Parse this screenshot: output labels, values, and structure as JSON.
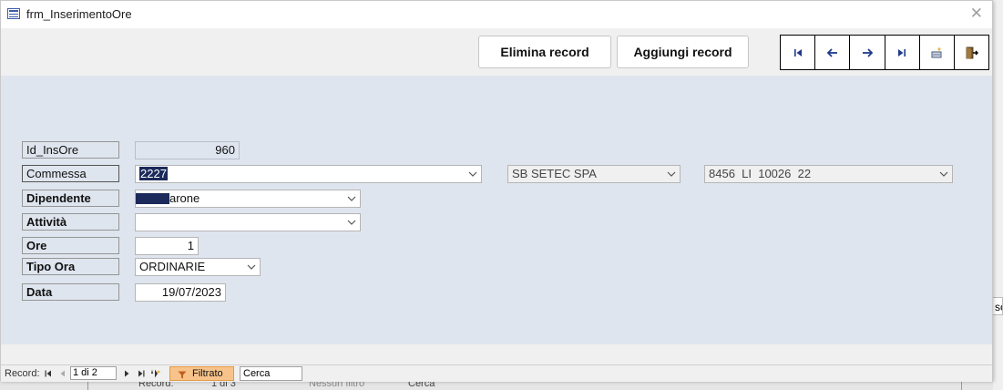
{
  "window": {
    "title": "frm_InserimentoOre"
  },
  "toolbar": {
    "delete_label": "Elimina record",
    "add_label": "Aggiungi record"
  },
  "nav_buttons": [
    "first-record-icon",
    "previous-record-icon",
    "next-record-icon",
    "last-record-icon",
    "new-record-icon",
    "exit-icon"
  ],
  "form": {
    "id_label": "Id_InsOre",
    "id_value": "960",
    "commessa_label": "Commessa",
    "commessa_value": "2227",
    "cliente_value": "SB SETEC SPA",
    "riferimento_value": "8456  LI  10026  22",
    "dipendente_label": "Dipendente",
    "dipendente_value": "arone",
    "attivita_label": "Attività",
    "attivita_value": "",
    "ore_label": "Ore",
    "ore_value": "1",
    "tipo_ora_label": "Tipo Ora",
    "tipo_ora_value": "ORDINARIE",
    "data_label": "Data",
    "data_value": "19/07/2023"
  },
  "record_nav": {
    "label": "Record:",
    "position": "1 di 2",
    "filter_label": "Filtrato",
    "search_placeholder": "Cerca"
  },
  "background": {
    "right_text": "sc",
    "record_label": "Record:",
    "position": "1 di 3",
    "filter_label": "Nessun filtro",
    "search_placeholder": "Cerca"
  },
  "colors": {
    "detail_bg": "#dfe5ee",
    "selection": "#1b2a5a",
    "filter_bg": "#f7c38a"
  }
}
